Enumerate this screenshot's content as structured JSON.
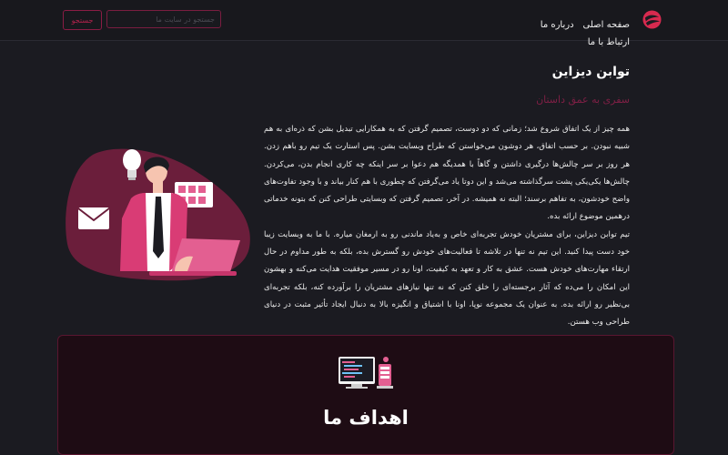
{
  "nav": {
    "logo_icon": "flame-logo",
    "links": [
      "صفحه اصلی",
      "درباره ما",
      "ارتباط با ما"
    ],
    "search_placeholder": "جستجو در سایت ما",
    "search_button_label": "جستجو"
  },
  "about": {
    "title": "توابن دیزاین",
    "subtitle": "سفری به عمق داستان",
    "paragraph_1": "همه چیز از یک اتفاق شروع شد؛ زمانی که دو دوست، تصمیم گرفتن که به همکارایی تبدیل بشن که ذره‌ای به هم شبیه نبودن. بر حسب اتفاق، هر دوشون می‌خواستن که طراح وبسایت بشن. پس استارت یک تیم رو باهم زدن. هر روز بر سر چالش‌ها درگیری داشتن و گاهاً با همدیگه هم دعوا بر سر اینکه چه کاری انجام بدن، می‌کردن. چالش‌ها یکی‌یکی پشت سرگذاشته می‌شد و این دوتا یاد می‌گرفتن که چطوری با هم کنار بیاند و با وجود تفاوت‌های واضح خودشون، به تفاهم برسند؛ البته نه همیشه. در آخر، تصمیم گرفتن که وبسایتی طراحی کنن که بتونه خدماتی درهمین موضوع ارائه بده.",
    "paragraph_2": "تیم توابن دیزاین، برای مشتریان خودش تجربه‌ای خاص و به‌یاد ماندنی رو به ارمغان میاره. با ما به وبسایت زیبا خود دست پیدا کنید. این تیم نه تنها در تلاشه تا فعالیت‌های خودش رو گسترش بده، بلکه به طور مداوم در حال ارتقاء مهارت‌های خودش هست. عشق به کار و تعهد به کیفیت، اونا رو در مسیر موفقیت هدایت می‌کنه و بهشون این امکان را می‌ده که آثار برجسته‌ای را خلق کنن که نه تنها نیازهای مشتریان را برآورده کنه، بلکه تجربه‌ای بی‌نظیر رو ارائه بده. به عنوان یک مجموعه نوپا، اونا با اشتیاق و انگیزه بالا به دنبال ایجاد تأثیر مثبت در دنیای طراحی وب هستن.",
    "illustration": "developer-at-laptop-illustration"
  },
  "goals": {
    "icon": "code-screen-icon",
    "title": "اهداف ما"
  },
  "colors": {
    "background": "#1b1b21",
    "navbar": "#18181d",
    "accent": "#b5224d",
    "card_background": "#1e0c14"
  }
}
